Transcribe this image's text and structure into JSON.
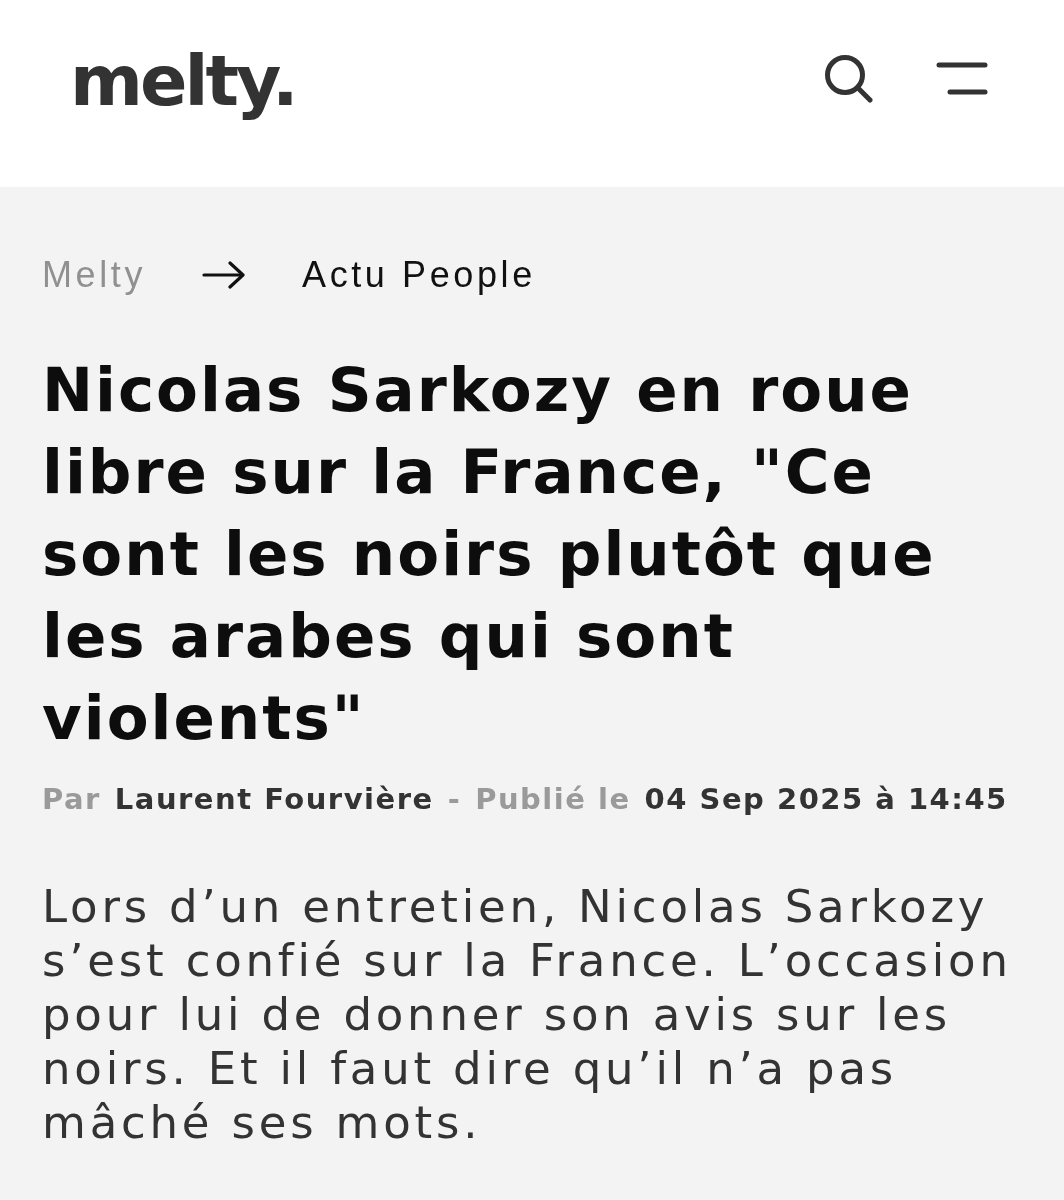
{
  "header": {
    "logo": "melty."
  },
  "breadcrumb": [
    {
      "label": "Melty",
      "current": false
    },
    {
      "label": "Actu People",
      "current": true
    }
  ],
  "article": {
    "title": "Nicolas Sarkozy en roue libre sur la France, \"Ce sont les noirs plutôt que les arabes qui sont violents\"",
    "byline": {
      "by_label": "Par",
      "author": "Laurent Fourvière",
      "separator": "-",
      "published_label": "Publié le",
      "date": "04 Sep 2025 à 14:45"
    },
    "lede": "Lors d’un entretien, Nicolas Sarkozy s’est confié sur la France. L’occasion pour lui de donner son avis sur les noirs. Et il faut dire qu’il n’a pas mâché ses mots."
  }
}
